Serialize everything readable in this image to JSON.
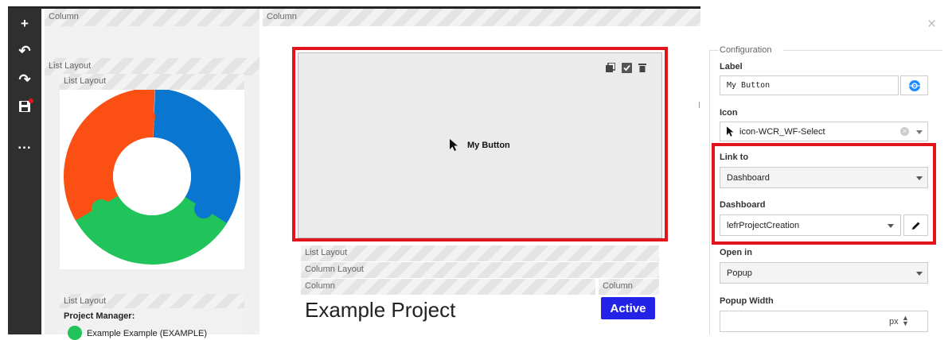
{
  "toolbar": {
    "add_icon": "+",
    "undo_icon": "↶",
    "redo_icon": "↷",
    "save_icon": "save",
    "more_icon": "..."
  },
  "left": {
    "column_label": "Column",
    "list_layout_outer": "List Layout",
    "list_layout_inner": "List Layout",
    "list_layout_bottom": "List Layout",
    "project_manager_label": "Project Manager:",
    "manager_partial": "Example Example (EXAMPLE)"
  },
  "center": {
    "column_label": "Column",
    "button_label": "My Button",
    "list_layout": "List Layout",
    "column_layout": "Column Layout",
    "column_a": "Column",
    "column_b": "Column",
    "project_title": "Example Project",
    "status_badge": "Active"
  },
  "config": {
    "legend": "Configuration",
    "label_title": "Label",
    "label_value": "My Button",
    "icon_title": "Icon",
    "icon_value": "icon-WCR_WF-Select",
    "link_to_title": "Link to",
    "link_to_value": "Dashboard",
    "dashboard_title": "Dashboard",
    "dashboard_value": "lefrProjectCreation",
    "open_in_title": "Open in",
    "open_in_value": "Popup",
    "popup_width_title": "Popup Width",
    "popup_width_unit": "px",
    "close_icon": "×"
  },
  "colors": {
    "highlight_red": "#e3141c",
    "badge_blue": "#2323e8",
    "puzzle_orange": "#fb4f14",
    "puzzle_blue": "#0b76d0",
    "puzzle_green": "#21c45a",
    "toolbar_dark": "#2f2f2f"
  }
}
